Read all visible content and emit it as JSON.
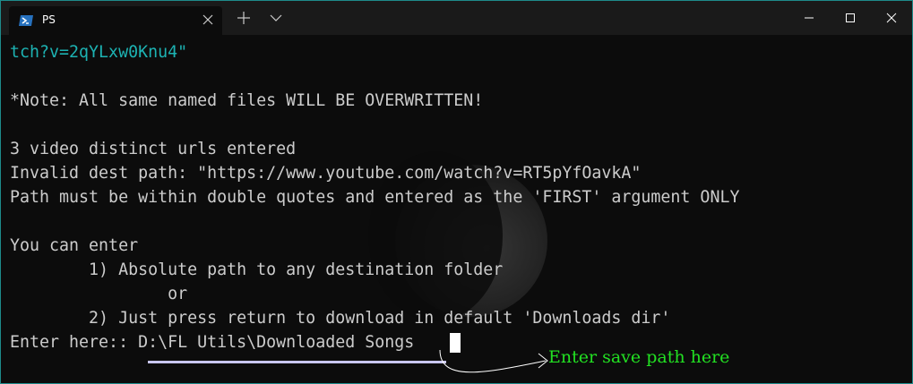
{
  "titlebar": {
    "tab_title": "PS",
    "tab_icon": "powershell-icon",
    "close_icon": "close-icon",
    "new_tab_icon": "plus-icon",
    "dropdown_icon": "chevron-down-icon",
    "minimize_icon": "minimize-icon",
    "maximize_icon": "maximize-icon",
    "window_close_icon": "close-icon"
  },
  "terminal": {
    "lines": [
      "tch?v=2qYLxw0Knu4\"",
      "",
      "*Note: All same named files WILL BE OVERWRITTEN!",
      "",
      "3 video distinct urls entered",
      "Invalid dest path: \"https://www.youtube.com/watch?v=RT5pYfOavkA\"",
      "Path must be within double quotes and entered as the 'FIRST' argument ONLY",
      "",
      "You can enter",
      "        1) Absolute path to any destination folder",
      "                or",
      "        2) Just press return to download in default 'Downloads dir'",
      "Enter here:: D:\\FL Utils\\Downloaded Songs"
    ],
    "prompt_label": "Enter here:: ",
    "prompt_value": "D:\\FL Utils\\Downloaded Songs"
  },
  "annotation": {
    "text": "Enter save path here",
    "color": "#22e022"
  },
  "colors": {
    "background": "#0c0c0c",
    "text": "#cccccc",
    "url_text": "#1db3b3",
    "window_border": "#1e8b8b",
    "underline": "#c9c7f0"
  }
}
